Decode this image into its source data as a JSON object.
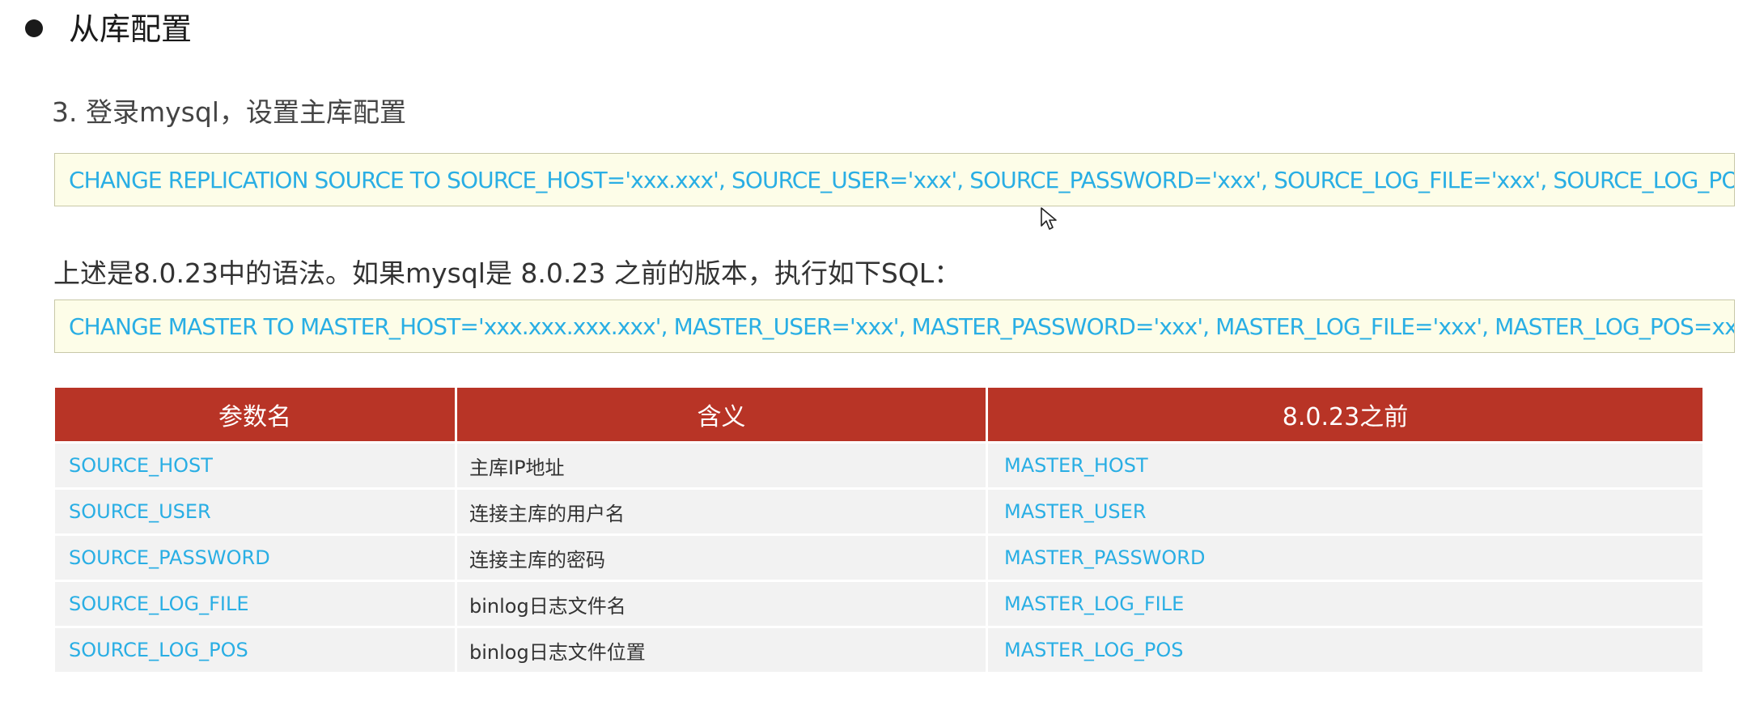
{
  "section": {
    "title": "从库配置"
  },
  "step": {
    "title": "3. 登录mysql，设置主库配置"
  },
  "code_new": "CHANGE REPLICATION SOURCE TO SOURCE_HOST='xxx.xxx', SOURCE_USER='xxx', SOURCE_PASSWORD='xxx', SOURCE_LOG_FILE='xxx', SOURCE_LOG_POS=xxx;",
  "note": "上述是8.0.23中的语法。如果mysql是 8.0.23 之前的版本，执行如下SQL：",
  "code_old": "CHANGE MASTER TO MASTER_HOST='xxx.xxx.xxx.xxx', MASTER_USER='xxx', MASTER_PASSWORD='xxx', MASTER_LOG_FILE='xxx', MASTER_LOG_POS=xxx;",
  "table": {
    "headers": [
      "参数名",
      "含义",
      "8.0.23之前"
    ],
    "rows": [
      [
        "SOURCE_HOST",
        "主库IP地址",
        "MASTER_HOST"
      ],
      [
        "SOURCE_USER",
        "连接主库的用户名",
        "MASTER_USER"
      ],
      [
        "SOURCE_PASSWORD",
        "连接主库的密码",
        "MASTER_PASSWORD"
      ],
      [
        "SOURCE_LOG_FILE",
        "binlog日志文件名",
        "MASTER_LOG_FILE"
      ],
      [
        "SOURCE_LOG_POS",
        "binlog日志文件位置",
        "MASTER_LOG_POS"
      ]
    ]
  },
  "colors": {
    "accent_code": "#29aee4",
    "header_bg": "#b83426",
    "code_bg": "#fdfde8",
    "row_bg": "#f2f2f2"
  },
  "icons": {
    "bullet": "bullet-dot-icon",
    "cursor": "mouse-pointer-icon"
  }
}
